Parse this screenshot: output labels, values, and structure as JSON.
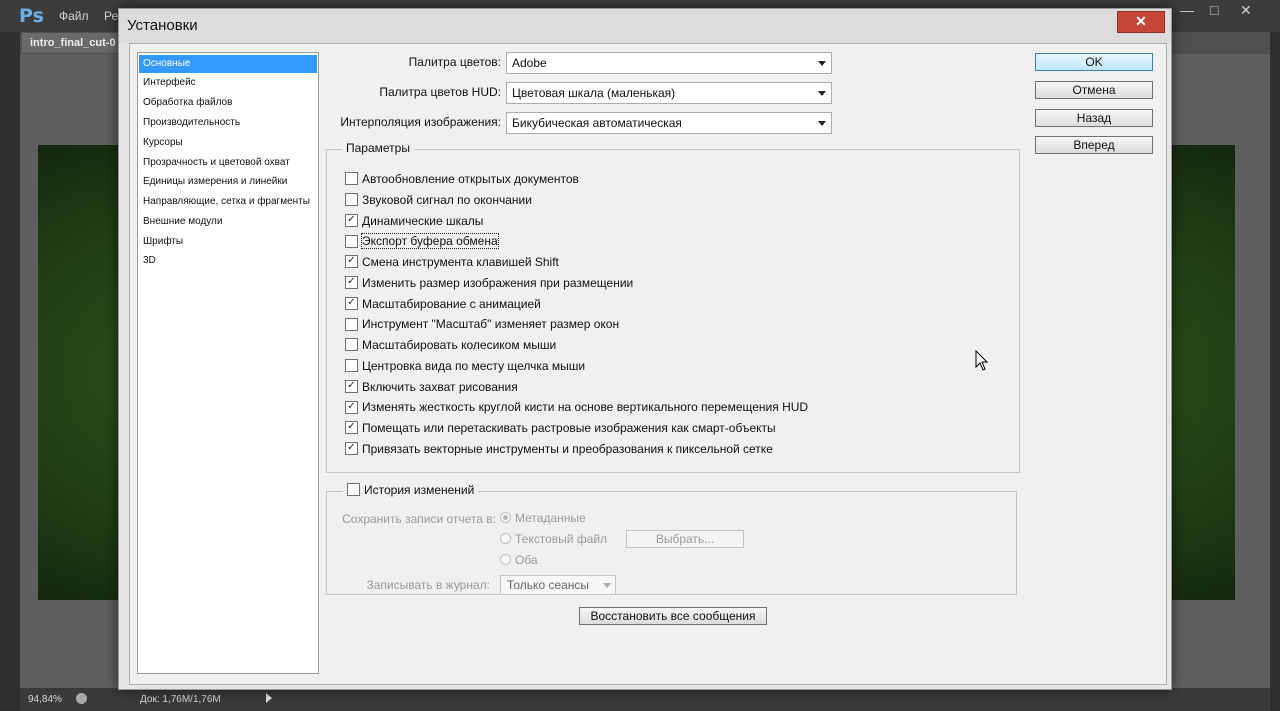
{
  "ps": {
    "logo": "Ps",
    "menu": [
      "Файл",
      "Ре"
    ],
    "window_buttons": [
      "—",
      "□",
      "✕"
    ],
    "document_tab": "intro_final_cut-0",
    "status": {
      "zoom": "94,84%",
      "doc_info": "Док: 1,76M/1,76M"
    }
  },
  "dialog": {
    "title": "Установки",
    "close_label": "✕",
    "sidebar": [
      "Основные",
      "Интерфейс",
      "Обработка файлов",
      "Производительность",
      "Курсоры",
      "Прозрачность и цветовой охват",
      "Единицы измерения и линейки",
      "Направляющие, сетка и фрагменты",
      "Внешние модули",
      "Шрифты",
      "3D"
    ],
    "selected_sidebar_index": 0,
    "fields": [
      {
        "label": "Палитра цветов:",
        "value": "Adobe"
      },
      {
        "label": "Палитра цветов HUD:",
        "value": "Цветовая шкала (маленькая)"
      },
      {
        "label": "Интерполяция изображения:",
        "value": "Бикубическая автоматическая"
      }
    ],
    "options_group_title": "Параметры",
    "options": [
      {
        "label": "Автообновление открытых документов",
        "checked": false
      },
      {
        "label": "Звуковой сигнал по окончании",
        "checked": false
      },
      {
        "label": "Динамические шкалы",
        "checked": true
      },
      {
        "label": "Экспорт буфера обмена",
        "checked": false,
        "focused": true
      },
      {
        "label": "Смена инструмента клавишей Shift",
        "checked": true
      },
      {
        "label": "Изменить размер изображения при размещении",
        "checked": true
      },
      {
        "label": "Масштабирование с анимацией",
        "checked": true
      },
      {
        "label": "Инструмент \"Масштаб\" изменяет размер окон",
        "checked": false
      },
      {
        "label": "Масштабировать колесиком мыши",
        "checked": false
      },
      {
        "label": "Центровка вида по месту щелчка мыши",
        "checked": false
      },
      {
        "label": "Включить захват рисования",
        "checked": true
      },
      {
        "label": "Изменять жесткость круглой кисти на основе вертикального перемещения HUD",
        "checked": true
      },
      {
        "label": "Помещать или перетаскивать растровые изображения как смарт-объекты",
        "checked": true
      },
      {
        "label": "Привязать векторные инструменты и преобразования к пиксельной сетке",
        "checked": true
      }
    ],
    "history": {
      "title": "История изменений",
      "checked": false,
      "save_label": "Сохранить записи отчета в:",
      "radios": [
        "Метаданные",
        "Текстовый файл",
        "Оба"
      ],
      "selected_radio": 0,
      "choose_button": "Выбрать...",
      "journal_label": "Записывать в журнал:",
      "journal_value": "Только сеансы"
    },
    "restore_button": "Восстановить все сообщения",
    "buttons": {
      "ok": "OK",
      "cancel": "Отмена",
      "back": "Назад",
      "forward": "Вперед"
    }
  }
}
